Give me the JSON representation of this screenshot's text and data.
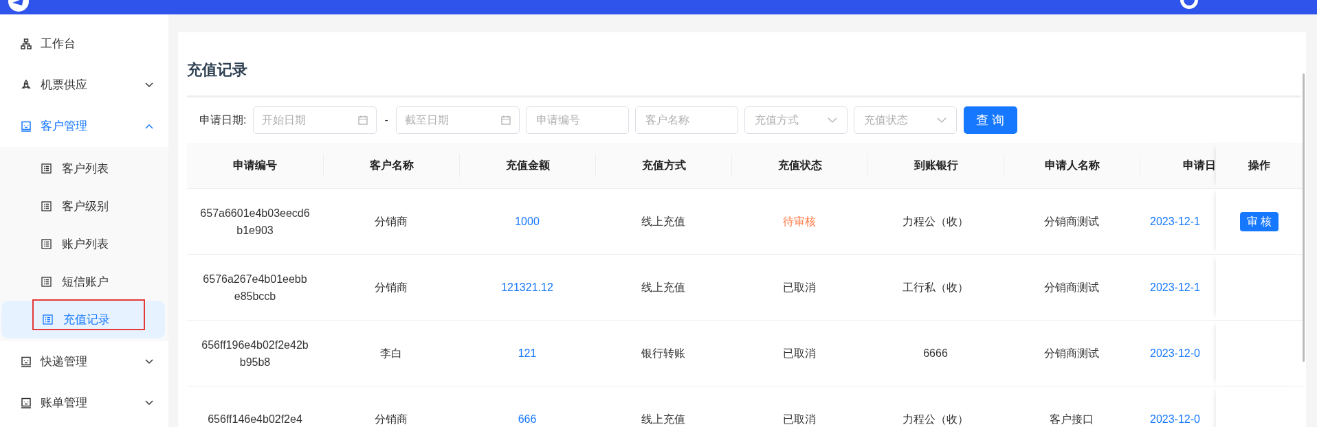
{
  "sidebar": {
    "items": [
      {
        "label": "工作台",
        "selected": false
      },
      {
        "label": "机票供应",
        "expanded": false,
        "selected": false
      },
      {
        "label": "客户管理",
        "expanded": true,
        "selected": true,
        "children": [
          {
            "label": "客户列表",
            "selected": false
          },
          {
            "label": "客户级别",
            "selected": false
          },
          {
            "label": "账户列表",
            "selected": false
          },
          {
            "label": "短信账户",
            "selected": false
          },
          {
            "label": "充值记录",
            "selected": true,
            "highlighted": true
          }
        ]
      },
      {
        "label": "快递管理",
        "expanded": false,
        "selected": false
      },
      {
        "label": "账单管理",
        "expanded": false,
        "selected": false
      }
    ]
  },
  "page": {
    "title": "充值记录"
  },
  "filters": {
    "date_label": "申请日期:",
    "start_placeholder": "开始日期",
    "separator": "-",
    "end_placeholder": "截至日期",
    "fields": [
      {
        "kind": "text",
        "placeholder": "申请编号"
      },
      {
        "kind": "text",
        "placeholder": "客户名称"
      },
      {
        "kind": "select",
        "placeholder": "充值方式"
      },
      {
        "kind": "select",
        "placeholder": "充值状态"
      }
    ],
    "search_button": "查 询"
  },
  "table": {
    "columns": [
      "申请编号",
      "客户名称",
      "充值金额",
      "充值方式",
      "充值状态",
      "到账银行",
      "申请人名称",
      "申请日",
      "操作"
    ],
    "rows": [
      {
        "id": "657a6601e4b03eecd6b1e903",
        "customer": "分销商",
        "amount": "1000",
        "method": "线上充值",
        "status": "待审核",
        "color": "#ff7a45",
        "bank": "力程公（收）",
        "applicant": "分销商测试",
        "date": "2023-12-1",
        "action": "审 核"
      },
      {
        "id": "6576a267e4b01eebbe85bccb",
        "customer": "分销商",
        "amount": "121321.12",
        "method": "线上充值",
        "status": "已取消",
        "color": "#333333",
        "bank": "工行私（收）",
        "applicant": "分销商测试",
        "date": "2023-12-1"
      },
      {
        "id": "656ff196e4b02f2e42bb95b8",
        "customer": "李白",
        "amount": "121",
        "method": "银行转账",
        "status": "已取消",
        "color": "#333333",
        "bank": "6666",
        "applicant": "分销商测试",
        "date": "2023-12-0"
      },
      {
        "id": "656ff146e4b02f2e4",
        "customer": "分销商",
        "amount": "666",
        "method": "线上充值",
        "status": "已取消",
        "color": "#333333",
        "bank": "力程公（收）",
        "applicant": "客户接口",
        "date": "2023-12-0"
      }
    ]
  }
}
